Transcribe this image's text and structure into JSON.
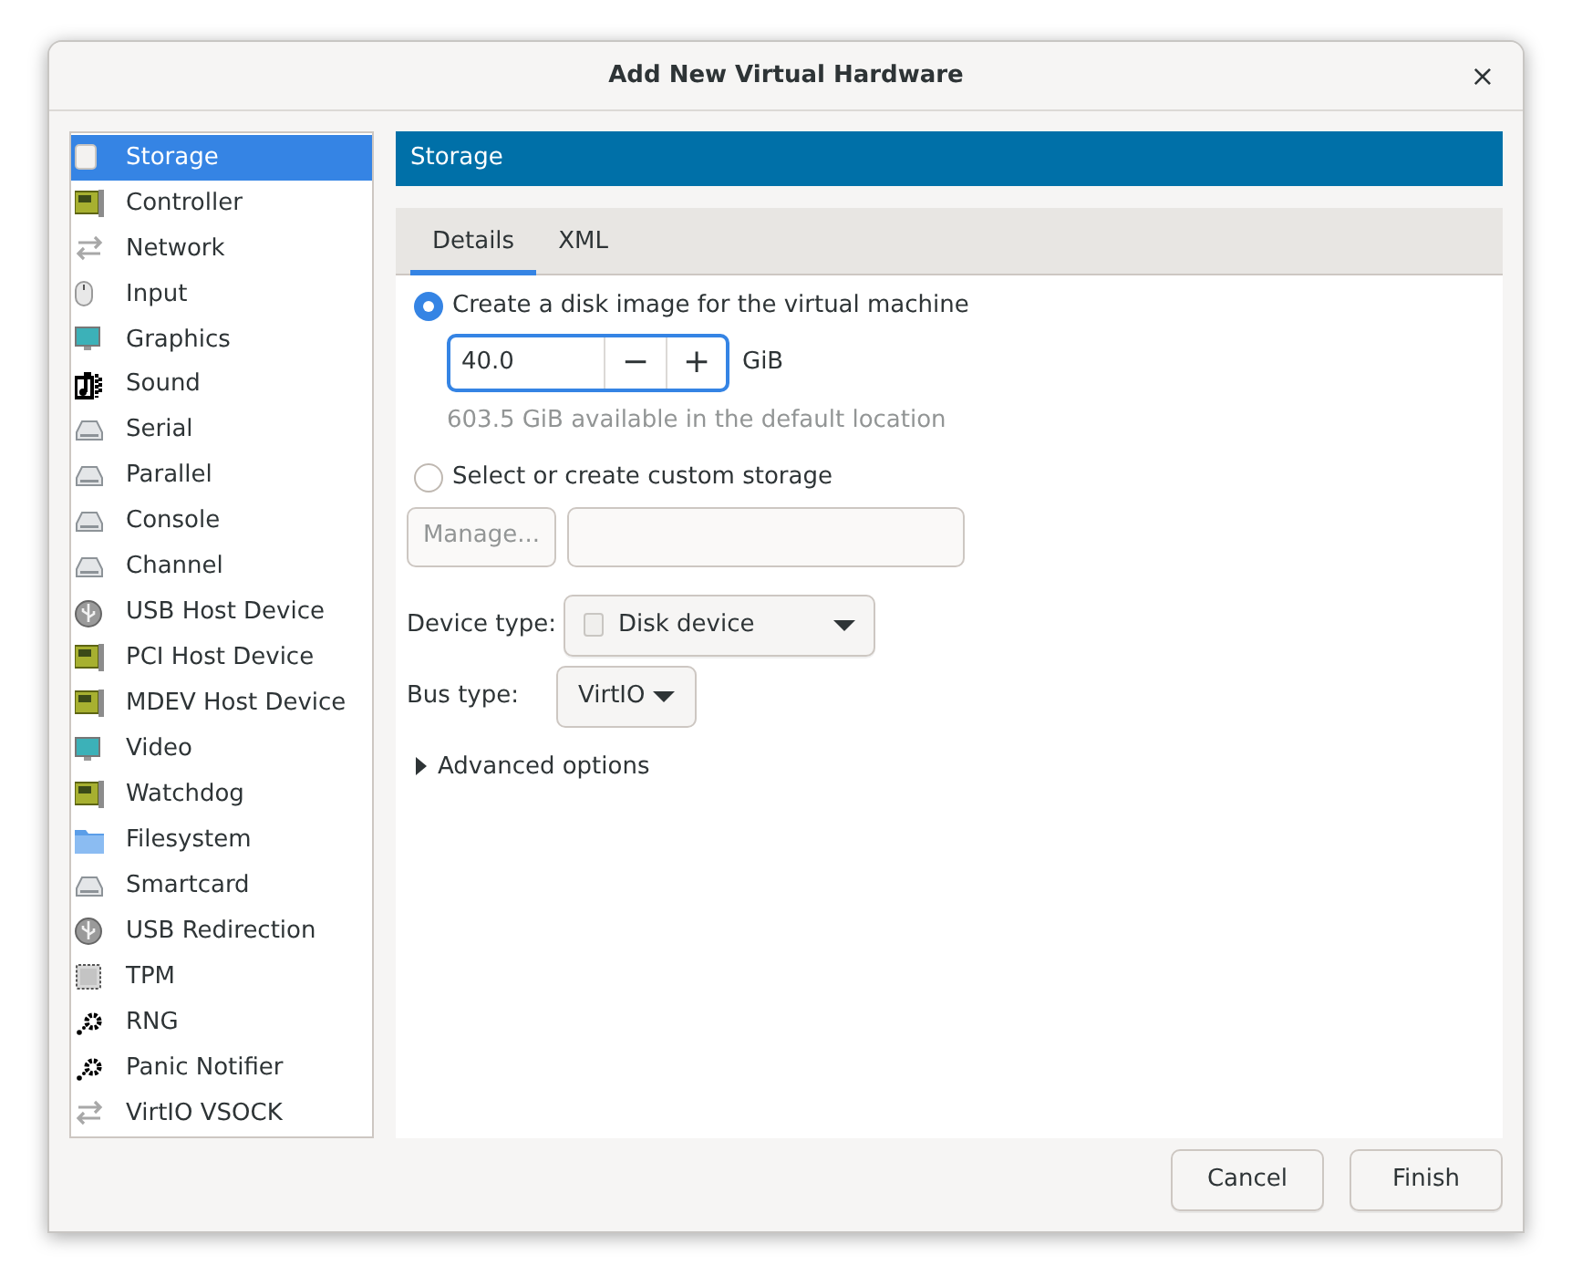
{
  "window": {
    "title": "Add New Virtual Hardware",
    "close": "×"
  },
  "sidebar": {
    "items": [
      {
        "label": "Storage",
        "kind": "disk",
        "selected": true
      },
      {
        "label": "Controller",
        "kind": "card",
        "selected": false
      },
      {
        "label": "Network",
        "kind": "arrows",
        "selected": false
      },
      {
        "label": "Input",
        "kind": "mouse",
        "selected": false
      },
      {
        "label": "Graphics",
        "kind": "monitor",
        "selected": false
      },
      {
        "label": "Sound",
        "kind": "sound",
        "selected": false
      },
      {
        "label": "Serial",
        "kind": "port",
        "selected": false
      },
      {
        "label": "Parallel",
        "kind": "port",
        "selected": false
      },
      {
        "label": "Console",
        "kind": "port",
        "selected": false
      },
      {
        "label": "Channel",
        "kind": "port",
        "selected": false
      },
      {
        "label": "USB Host Device",
        "kind": "usb",
        "selected": false
      },
      {
        "label": "PCI Host Device",
        "kind": "card",
        "selected": false
      },
      {
        "label": "MDEV Host Device",
        "kind": "card",
        "selected": false
      },
      {
        "label": "Video",
        "kind": "monitor",
        "selected": false
      },
      {
        "label": "Watchdog",
        "kind": "card",
        "selected": false
      },
      {
        "label": "Filesystem",
        "kind": "folder",
        "selected": false
      },
      {
        "label": "Smartcard",
        "kind": "port",
        "selected": false
      },
      {
        "label": "USB Redirection",
        "kind": "usb",
        "selected": false
      },
      {
        "label": "TPM",
        "kind": "chip",
        "selected": false
      },
      {
        "label": "RNG",
        "kind": "gears",
        "selected": false
      },
      {
        "label": "Panic Notifier",
        "kind": "gears",
        "selected": false
      },
      {
        "label": "VirtIO VSOCK",
        "kind": "arrows",
        "selected": false
      }
    ]
  },
  "panel": {
    "header": "Storage",
    "tabs": [
      {
        "label": "Details",
        "selected": true
      },
      {
        "label": "XML",
        "selected": false
      }
    ],
    "create_option": {
      "label": "Create a disk image for the virtual machine",
      "selected": true
    },
    "size": {
      "value": "40.0",
      "minus": "−",
      "plus": "+",
      "unit": "GiB"
    },
    "available": "603.5 GiB available in the default location",
    "custom_option": {
      "label": "Select or create custom storage",
      "selected": false
    },
    "manage_button": {
      "label": "Manage...",
      "disabled": true
    },
    "device_type": {
      "label": "Device type:",
      "value": "Disk device"
    },
    "bus_type": {
      "label": "Bus type:",
      "value": "VirtIO"
    },
    "advanced": {
      "label": "Advanced options",
      "expanded": false
    }
  },
  "buttons": [
    {
      "label": "Cancel"
    },
    {
      "label": "Finish"
    }
  ]
}
